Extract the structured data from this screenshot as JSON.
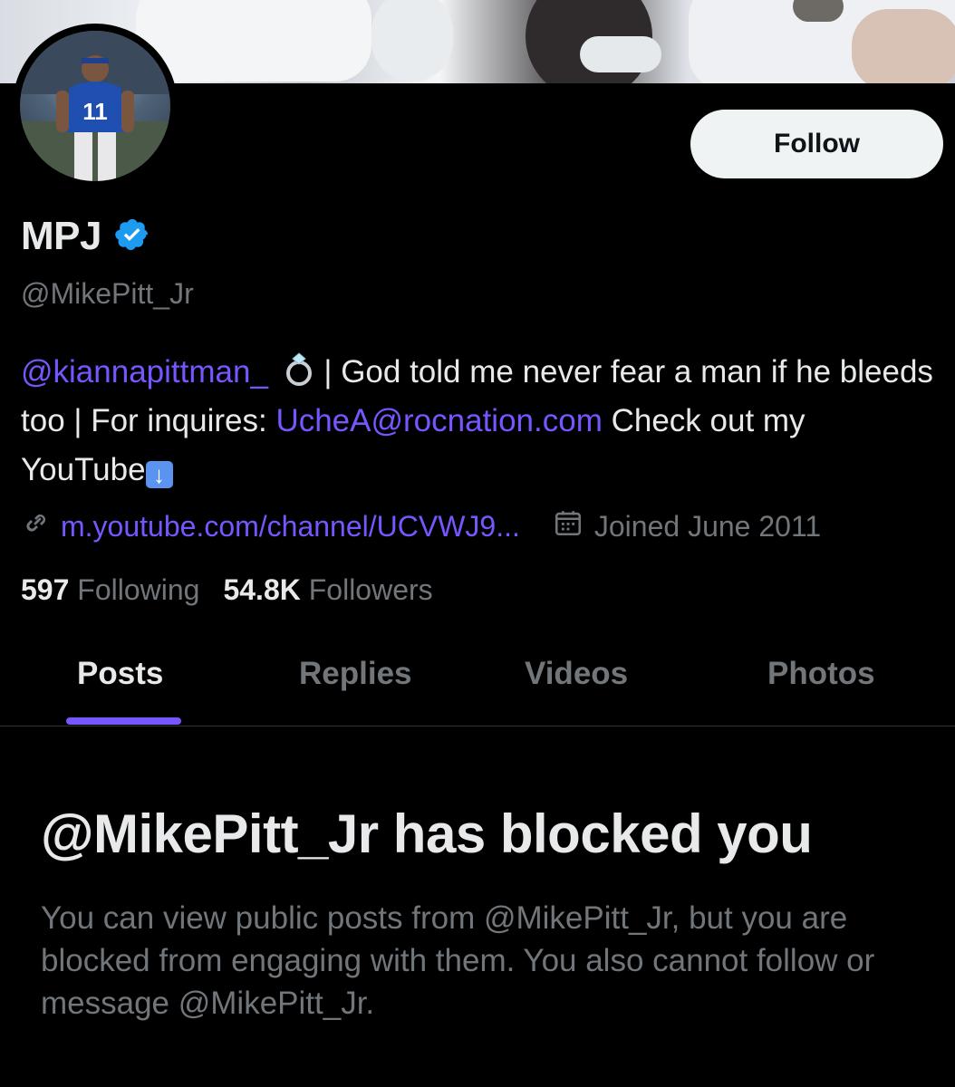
{
  "profile": {
    "display_name": "MPJ",
    "handle": "@MikePitt_Jr",
    "verified": true,
    "follow_label": "Follow",
    "bio": {
      "mention": "@kiannapittman_",
      "text1": " | God told me never fear a man if he bleeds too | For inquires: ",
      "email": "UcheA@rocnation.com",
      "text2": " Check out my YouTube"
    },
    "website": "m.youtube.com/channel/UCVWJ9...",
    "joined": "Joined June 2011",
    "following_count": "597",
    "following_label": "Following",
    "followers_count": "54.8K",
    "followers_label": "Followers"
  },
  "tabs": [
    {
      "label": "Posts"
    },
    {
      "label": "Replies"
    },
    {
      "label": "Videos"
    },
    {
      "label": "Photos"
    }
  ],
  "blocked": {
    "title": "@MikePitt_Jr has blocked you",
    "description": "You can view public posts from @MikePitt_Jr, but you are blocked from engaging with them. You also cannot follow or message @MikePitt_Jr."
  },
  "colors": {
    "accent": "#7856ff",
    "verified": "#1d9bf0",
    "muted": "#71767b",
    "background": "#000000"
  },
  "icons": {
    "verified": "verified-badge-icon",
    "link": "link-icon",
    "calendar": "calendar-icon",
    "ring_emoji": "ring-emoji",
    "arrow_emoji": "down-arrow-emoji"
  }
}
